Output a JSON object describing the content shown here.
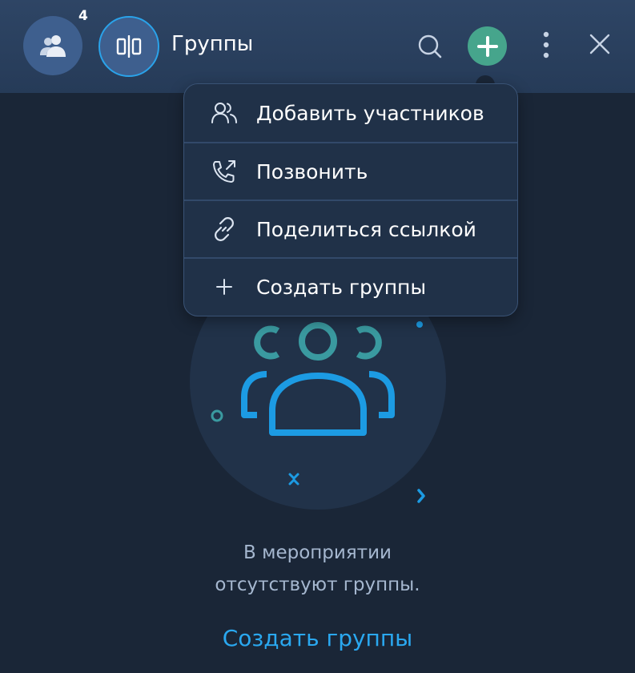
{
  "header": {
    "title": "Группы",
    "participants_count": "4",
    "participants_icon": "users-icon",
    "layout_icon": "split-view-icon",
    "search_icon": "search-icon",
    "add_icon": "plus-icon",
    "more_icon": "more-vertical-icon",
    "close_icon": "close-icon"
  },
  "menu": {
    "items": [
      {
        "label": "Добавить участников",
        "icon": "add-users-icon"
      },
      {
        "label": "Позвонить",
        "icon": "phone-call-icon"
      },
      {
        "label": "Поделиться ссылкой",
        "icon": "link-icon"
      },
      {
        "label": "Создать группы",
        "icon": "plus-icon"
      }
    ]
  },
  "empty_state": {
    "line1": "В мероприятии",
    "line2": "отсутствуют группы.",
    "action": "Создать группы",
    "illustration_icon": "groups-icon"
  },
  "colors": {
    "background": "#1a2637",
    "header": "#2b4262",
    "accent_blue": "#2aa8f0",
    "accent_green": "#46a58c",
    "teal": "#3a9aa0"
  }
}
